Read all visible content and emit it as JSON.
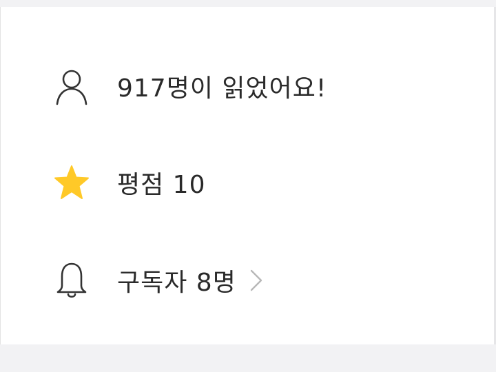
{
  "stats": {
    "readers_text": "917명이 읽었어요!",
    "rating_text": "평점 10",
    "subscribers_text": "구독자 8명"
  },
  "icons": {
    "readers": "person-icon",
    "rating": "star-icon",
    "subscribers": "bell-icon",
    "more": "chevron-right-icon"
  },
  "colors": {
    "star": "#ffc928",
    "text": "#2a2a2a",
    "icon_stroke": "#333333",
    "chevron": "#b8b8b8"
  }
}
